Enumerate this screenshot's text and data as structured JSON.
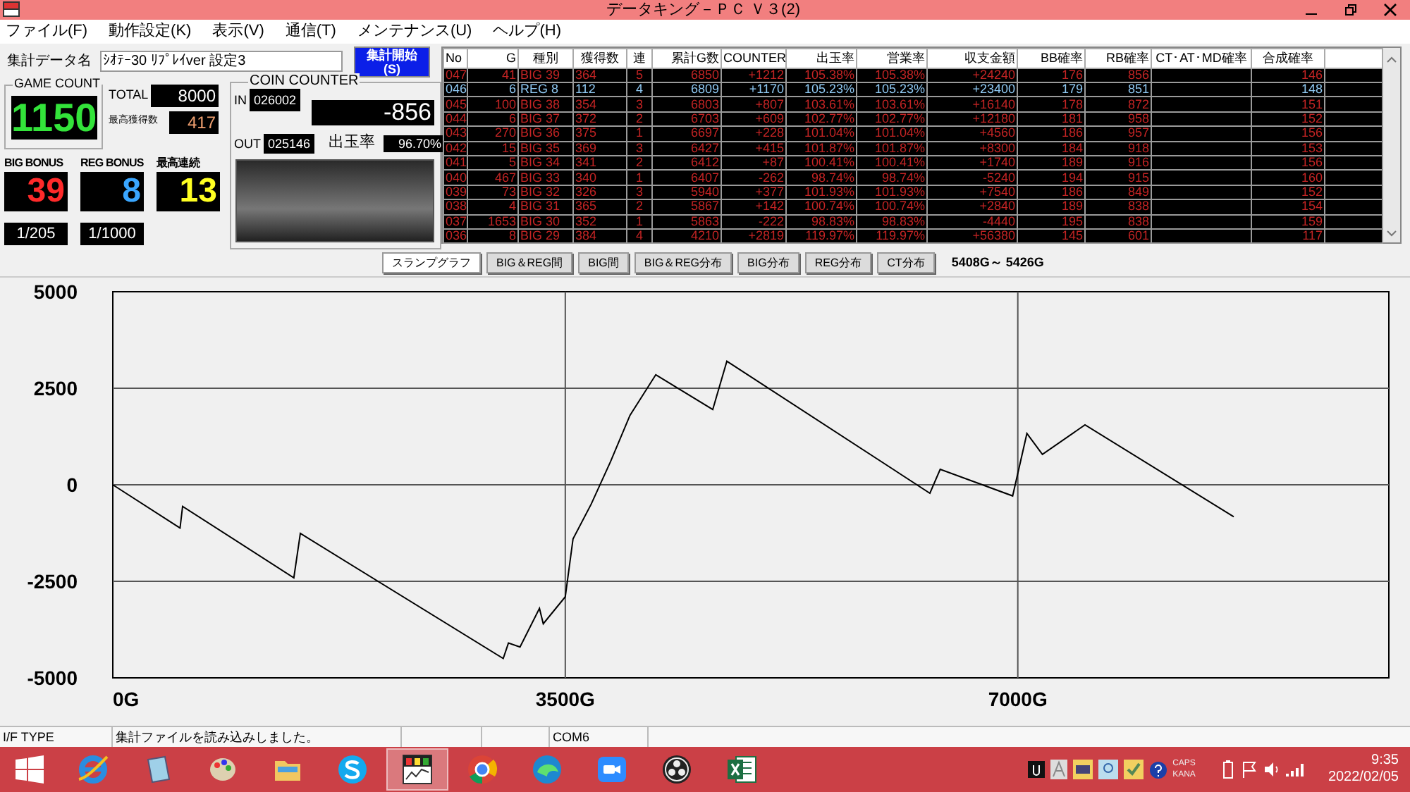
{
  "window": {
    "title": "データキング－ＰＣ Ｖ３(2)"
  },
  "menu": [
    "ファイル(F)",
    "動作設定(K)",
    "表示(V)",
    "通信(T)",
    "メンテナンス(U)",
    "ヘルプ(H)"
  ],
  "aggregate": {
    "label": "集計データ名",
    "value": "ｼｵﾃｰ30 ﾘﾌﾟﾚｲver 設定3",
    "start_button": [
      "集計開始",
      "(S)"
    ]
  },
  "game_count": {
    "title": "GAME COUNT",
    "value": "1150"
  },
  "total": {
    "label": "TOTAL",
    "value": "8000"
  },
  "max_gain": {
    "label": "最高獲得数",
    "value": "417"
  },
  "bonuses": [
    {
      "label": "BIG BONUS",
      "value": "39",
      "rate": "1/205",
      "kind": "big"
    },
    {
      "label": "REG BONUS",
      "value": "8",
      "rate": "1/1000",
      "kind": "reg"
    },
    {
      "label": "最高連続",
      "value": "13",
      "kind": "streak"
    }
  ],
  "coin_counter": {
    "title": "COIN COUNTER",
    "in_label": "IN",
    "in_value": "026002",
    "difference": "-856",
    "out_label": "OUT",
    "out_value": "025146",
    "payout_label": "出玉率",
    "payout_value": "96.70%"
  },
  "history": {
    "columns": [
      "No",
      "G",
      "種別",
      "獲得数",
      "連",
      "累計G数",
      "COUNTER",
      "出玉率",
      "営業率",
      "収支金額",
      "BB確率",
      "RB確率",
      "CT･AT･MD確率",
      "合成確率"
    ],
    "rows": [
      {
        "kind": "big",
        "cells": [
          "047",
          "41",
          "BIG 39",
          "364",
          "5",
          "6850",
          "+1212",
          "105.38%",
          "105.38%",
          "+24240",
          "176",
          "856",
          "",
          "146"
        ]
      },
      {
        "kind": "reg",
        "cells": [
          "046",
          "6",
          "REG 8",
          "112",
          "4",
          "6809",
          "+1170",
          "105.23%",
          "105.23%",
          "+23400",
          "179",
          "851",
          "",
          "148"
        ]
      },
      {
        "kind": "big",
        "cells": [
          "045",
          "100",
          "BIG 38",
          "354",
          "3",
          "6803",
          "+807",
          "103.61%",
          "103.61%",
          "+16140",
          "178",
          "872",
          "",
          "151"
        ]
      },
      {
        "kind": "big",
        "cells": [
          "044",
          "6",
          "BIG 37",
          "372",
          "2",
          "6703",
          "+609",
          "102.77%",
          "102.77%",
          "+12180",
          "181",
          "958",
          "",
          "152"
        ]
      },
      {
        "kind": "big",
        "cells": [
          "043",
          "270",
          "BIG 36",
          "375",
          "1",
          "6697",
          "+228",
          "101.04%",
          "101.04%",
          "+4560",
          "186",
          "957",
          "",
          "156"
        ]
      },
      {
        "kind": "big",
        "cells": [
          "042",
          "15",
          "BIG 35",
          "369",
          "3",
          "6427",
          "+415",
          "101.87%",
          "101.87%",
          "+8300",
          "184",
          "918",
          "",
          "153"
        ]
      },
      {
        "kind": "big",
        "cells": [
          "041",
          "5",
          "BIG 34",
          "341",
          "2",
          "6412",
          "+87",
          "100.41%",
          "100.41%",
          "+1740",
          "189",
          "916",
          "",
          "156"
        ]
      },
      {
        "kind": "big",
        "cells": [
          "040",
          "467",
          "BIG 33",
          "340",
          "1",
          "6407",
          "-262",
          "98.74%",
          "98.74%",
          "-5240",
          "194",
          "915",
          "",
          "160"
        ]
      },
      {
        "kind": "big",
        "cells": [
          "039",
          "73",
          "BIG 32",
          "326",
          "3",
          "5940",
          "+377",
          "101.93%",
          "101.93%",
          "+7540",
          "186",
          "849",
          "",
          "152"
        ]
      },
      {
        "kind": "big",
        "cells": [
          "038",
          "4",
          "BIG 31",
          "365",
          "2",
          "5867",
          "+142",
          "100.74%",
          "100.74%",
          "+2840",
          "189",
          "838",
          "",
          "154"
        ]
      },
      {
        "kind": "big",
        "cells": [
          "037",
          "1653",
          "BIG 30",
          "352",
          "1",
          "5863",
          "-222",
          "98.83%",
          "98.83%",
          "-4440",
          "195",
          "838",
          "",
          "159"
        ]
      },
      {
        "kind": "big",
        "cells": [
          "036",
          "8",
          "BIG 29",
          "384",
          "4",
          "4210",
          "+2819",
          "119.97%",
          "119.97%",
          "+56380",
          "145",
          "601",
          "",
          "117"
        ]
      }
    ]
  },
  "graph_tabs": [
    {
      "label": "スランプグラフ",
      "selected": true
    },
    {
      "label": "BIG＆REG間",
      "selected": false
    },
    {
      "label": "BIG間",
      "selected": false
    },
    {
      "label": "BIG＆REG分布",
      "selected": false
    },
    {
      "label": "BIG分布",
      "selected": false
    },
    {
      "label": "REG分布",
      "selected": false
    },
    {
      "label": "CT分布",
      "selected": false
    }
  ],
  "range": "5408G～ 5426G",
  "chart_data": {
    "type": "line",
    "grid": true,
    "xlim": [
      0,
      9870
    ],
    "ylim": [
      -5000,
      5000
    ],
    "xticks": [
      {
        "value": 0,
        "label": "0G"
      },
      {
        "value": 3500,
        "label": "3500G"
      },
      {
        "value": 7000,
        "label": "7000G"
      }
    ],
    "yticks": [
      -5000,
      -2500,
      0,
      2500,
      5000
    ],
    "x": [
      0,
      520,
      540,
      1400,
      1450,
      3020,
      3060,
      3150,
      3300,
      3330,
      3500,
      3560,
      3700,
      3850,
      4000,
      4200,
      4640,
      4750,
      6320,
      6400,
      6960,
      7070,
      7190,
      7520,
      8670
    ],
    "series": [
      {
        "color": "#000000",
        "values": [
          0,
          -1120,
          -560,
          -2410,
          -1260,
          -4500,
          -4100,
          -4200,
          -3200,
          -3600,
          -2900,
          -1400,
          -500,
          600,
          1800,
          2850,
          1950,
          3200,
          -220,
          400,
          -290,
          1330,
          790,
          1550,
          -830
        ]
      }
    ]
  },
  "status_bar": [
    "I/F TYPE",
    "集計ファイルを読み込みしました。",
    "COM6"
  ],
  "taskbar": {
    "apps": [
      {
        "kind": "ie",
        "selected": false
      },
      {
        "kind": "tablet",
        "selected": false
      },
      {
        "kind": "palette",
        "selected": false
      },
      {
        "kind": "folder",
        "selected": false
      },
      {
        "kind": "skype",
        "selected": false
      },
      {
        "kind": "graph",
        "selected": true
      },
      {
        "kind": "chrome",
        "selected": false
      },
      {
        "kind": "edge",
        "selected": false
      },
      {
        "kind": "camera",
        "selected": false
      },
      {
        "kind": "obs",
        "selected": false
      },
      {
        "kind": "excel",
        "selected": false
      }
    ],
    "caps": "CAPS",
    "kana": "KANA",
    "time": "9:35",
    "date": "2022/02/05"
  }
}
